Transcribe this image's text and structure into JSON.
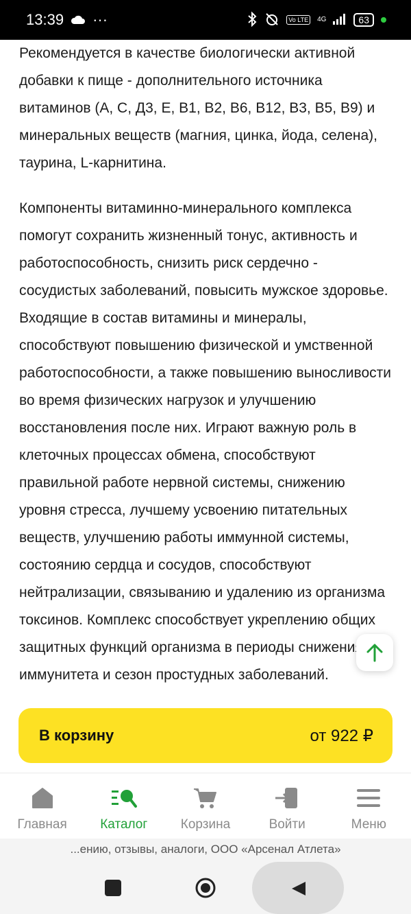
{
  "status_bar": {
    "time": "13:39",
    "ellipsis": "···",
    "network": "4G",
    "volte": "Vo LTE",
    "battery": "63"
  },
  "description": {
    "paragraph1": "Рекомендуется в качестве биологически активной добавки к пище - дополнительного источника витаминов (А, С, Д3, Е, В1, В2, В6, В12, В3, В5, В9) и минеральных веществ (магния, цинка, йода, селена), таурина, L-карнитина.",
    "paragraph2": "Компоненты витаминно-минерального комплекса помогут сохранить жизненный тонус, активность и работоспособность, снизить риск сердечно - сосудистых заболеваний, повысить мужское здоровье. Входящие в состав витамины и минералы, способствуют повышению физической и умственной работоспособности, а также повышению выносливости во время физических нагрузок и улучшению восстановления после них. Играют важную роль в клеточных процессах обмена, способствуют правильной работе нервной системы, снижению уровня стресса, лучшему усвоению питательных веществ, улучшению работы иммунной системы, состоянию сердца и сосудов, способствуют нейтрализации, связыванию и удалению из организма токсинов. Комплекс способствует укреплению общих защитных функций организма в периоды снижения иммунитета и сезон простудных заболеваний."
  },
  "cart": {
    "label": "В корзину",
    "price": "от 922 ₽",
    "accent": "#fde123"
  },
  "nav": {
    "items": [
      {
        "label": "Главная",
        "icon": "home-icon"
      },
      {
        "label": "Каталог",
        "icon": "catalog-icon",
        "active": true
      },
      {
        "label": "Корзина",
        "icon": "cart-icon"
      },
      {
        "label": "Войти",
        "icon": "login-icon"
      },
      {
        "label": "Меню",
        "icon": "menu-icon"
      }
    ],
    "active_color": "#21a038"
  },
  "url_strip": {
    "text": "...ению, отзывы, аналоги, ООО «Арсенал Атлета»"
  }
}
